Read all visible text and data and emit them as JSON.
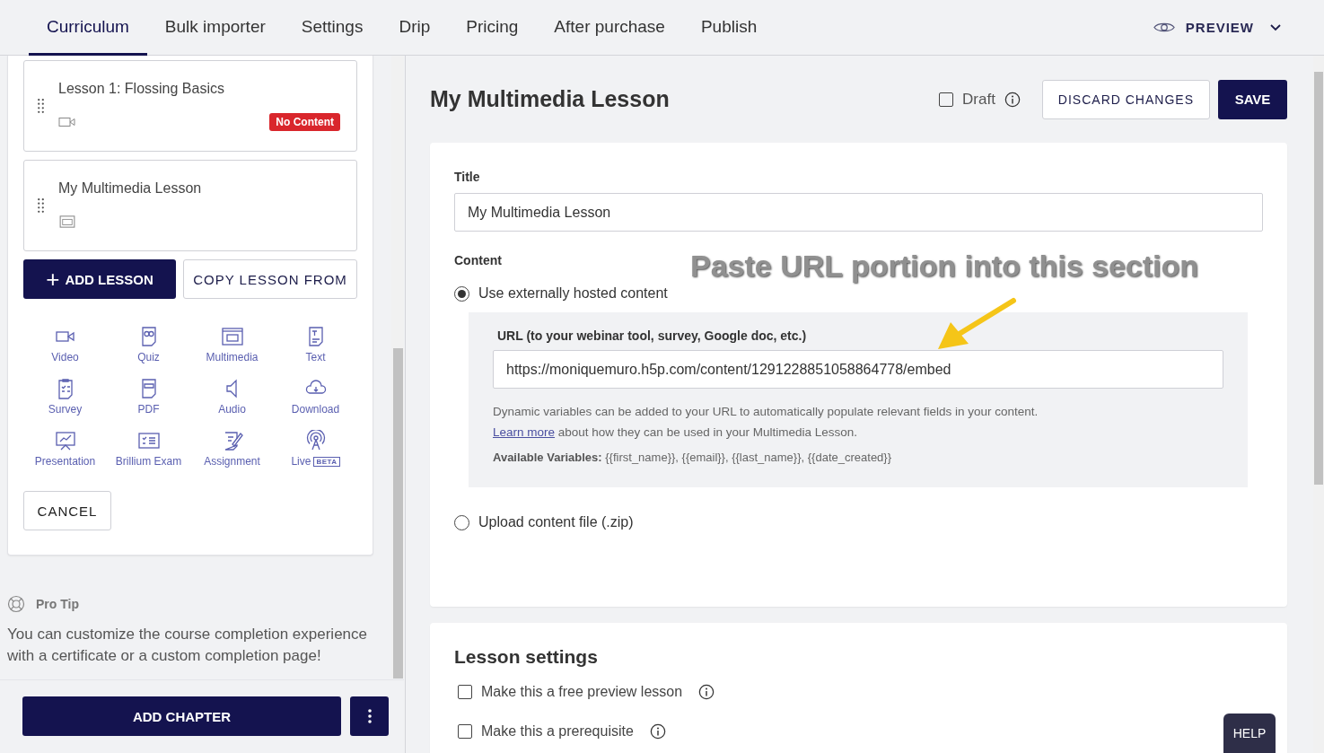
{
  "tabs": [
    {
      "label": "Curriculum",
      "selected": true
    },
    {
      "label": "Bulk importer",
      "selected": false
    },
    {
      "label": "Settings",
      "selected": false
    },
    {
      "label": "Drip",
      "selected": false
    },
    {
      "label": "Pricing",
      "selected": false
    },
    {
      "label": "After purchase",
      "selected": false
    },
    {
      "label": "Publish",
      "selected": false
    }
  ],
  "preview": {
    "label": "PREVIEW"
  },
  "lessons": [
    {
      "title": "Lesson 1: Flossing Basics",
      "kind": "video",
      "badge": "No Content"
    },
    {
      "title": "My Multimedia Lesson",
      "kind": "multimedia"
    }
  ],
  "add_lesson": {
    "icon": "+",
    "label": "ADD LESSON"
  },
  "copy_lesson_from": "COPY LESSON FROM",
  "lesson_types": [
    {
      "label": "Video",
      "kind": "video"
    },
    {
      "label": "Quiz",
      "kind": "quiz"
    },
    {
      "label": "Multimedia",
      "kind": "multimedia"
    },
    {
      "label": "Text",
      "kind": "text"
    },
    {
      "label": "Survey",
      "kind": "survey"
    },
    {
      "label": "PDF",
      "kind": "pdf"
    },
    {
      "label": "Audio",
      "kind": "audio"
    },
    {
      "label": "Download",
      "kind": "download"
    },
    {
      "label": "Presentation",
      "kind": "presentation"
    },
    {
      "label": "Brillium Exam",
      "kind": "exam"
    },
    {
      "label": "Assignment",
      "kind": "assignment"
    },
    {
      "label": "Live",
      "kind": "live",
      "badge": "BETA"
    }
  ],
  "cancel": "CANCEL",
  "pro_tip": {
    "title": "Pro Tip",
    "text": "You can customize the course completion experience with a certificate or a custom completion page!"
  },
  "add_chapter": "ADD CHAPTER",
  "editor": {
    "title": "My Multimedia Lesson",
    "draft": {
      "label": "Draft",
      "checked": false
    },
    "discard": "DISCARD CHANGES",
    "save": "SAVE",
    "title_label": "Title",
    "title_value": "My Multimedia Lesson",
    "content_label": "Content",
    "options": [
      {
        "label": "Use externally hosted content",
        "selected": true
      },
      {
        "label": "Upload content file (.zip)",
        "selected": false
      }
    ],
    "url_label": "URL (to your webinar tool, survey, Google doc, etc.)",
    "url_value": "https://moniquemuro.h5p.com/content/1291228851058864778/embed",
    "help_text": "Dynamic variables can be added to your URL to automatically populate relevant fields in your content.",
    "learn_more": "Learn more",
    "help_rest": "about how they can be used in your Multimedia Lesson.",
    "variables_label": "Available Variables:",
    "variables": "{{first_name}}, {{email}}, {{last_name}}, {{date_created}}"
  },
  "annotation": "Paste URL portion into this section",
  "lesson_settings": {
    "heading": "Lesson settings",
    "options": [
      {
        "label": "Make this a free preview lesson",
        "checked": false
      },
      {
        "label": "Make this a prerequisite",
        "checked": false
      }
    ]
  },
  "help": "HELP"
}
